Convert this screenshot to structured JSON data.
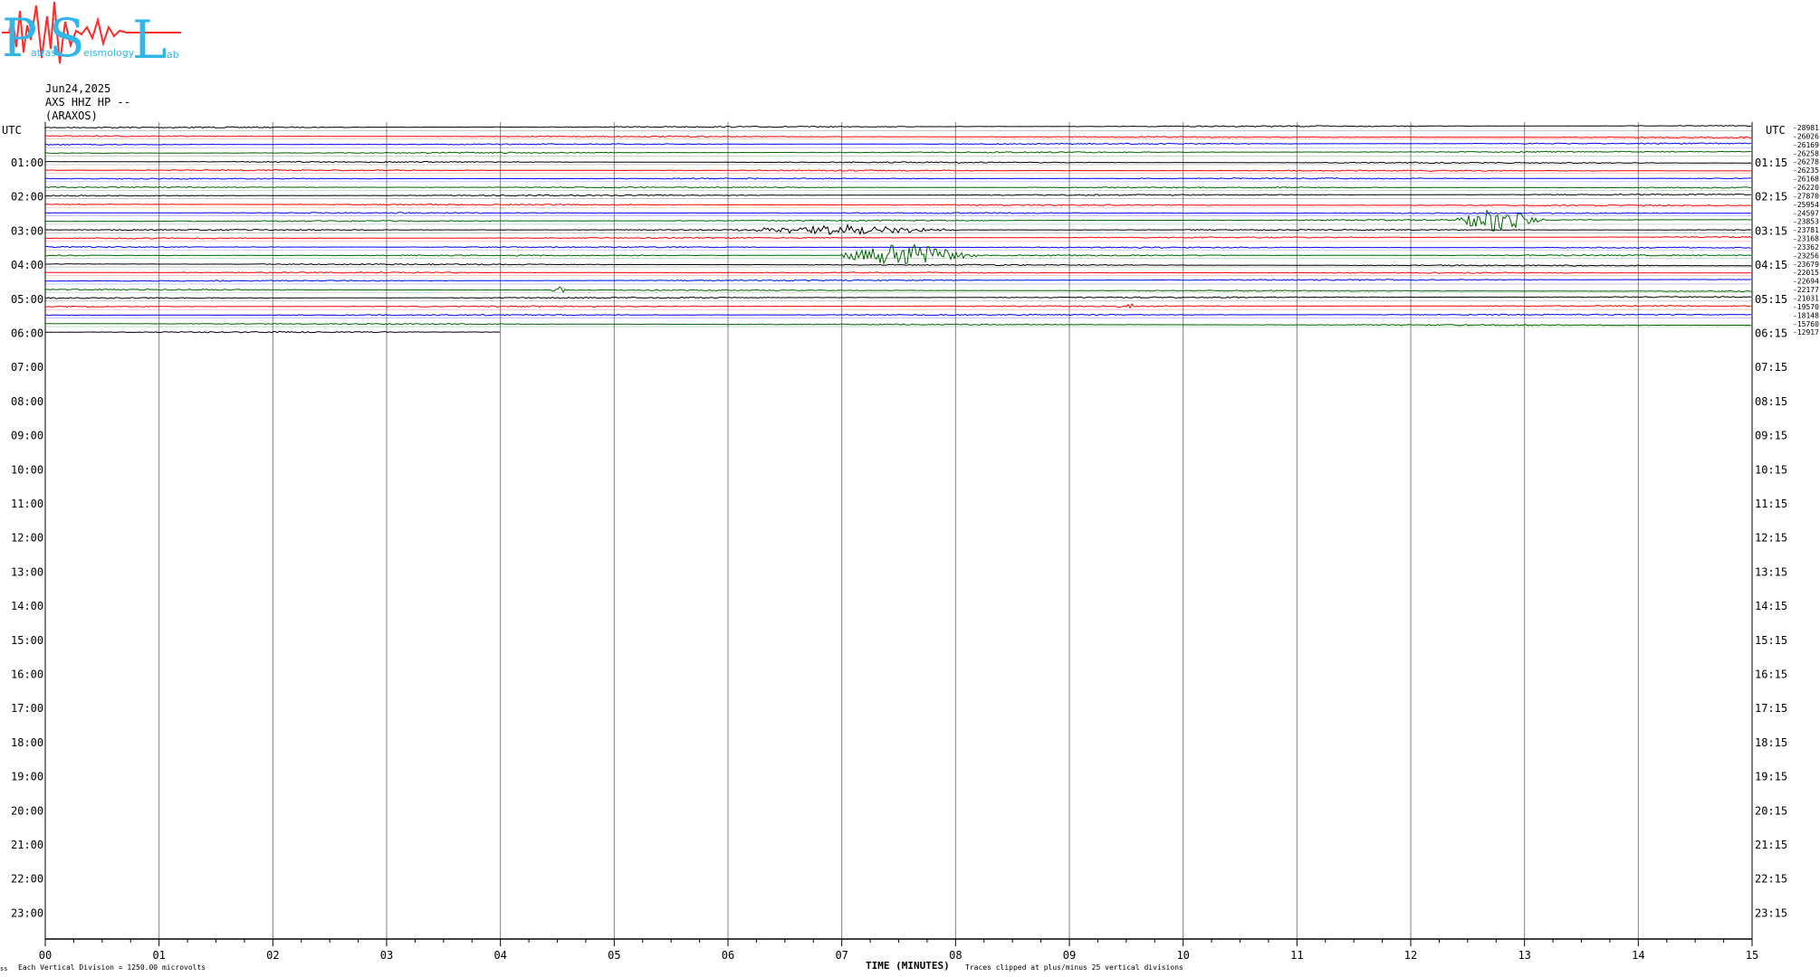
{
  "logo": {
    "letters": [
      "P",
      "S",
      "L"
    ],
    "small_words": [
      "atras",
      "eismology",
      "ab"
    ],
    "colors": {
      "letters": "#31b6e8",
      "wave": "#ff2a2a"
    }
  },
  "header": {
    "date": "Jun24,2025",
    "station_line": "AXS HHZ HP --",
    "station_name": "(ARAXOS)"
  },
  "footer": {
    "vertical_division": "Each Vertical Division = 1250.00 microvolts",
    "time_label": "TIME (MINUTES)",
    "clip_note": "Traces clipped at plus/minus 25 vertical divisions"
  },
  "chart_data": {
    "type": "line",
    "description_axes": {
      "x_ticks": [
        "00",
        "01",
        "02",
        "03",
        "04",
        "05",
        "06",
        "07",
        "08",
        "09",
        "10",
        "11",
        "12",
        "13",
        "14",
        "15"
      ],
      "x_range": [
        0,
        15
      ],
      "left_label": "UTC",
      "right_label": "UTC",
      "left_hours": [
        "01:00",
        "02:00",
        "03:00",
        "04:00",
        "05:00",
        "06:00",
        "07:00",
        "08:00",
        "09:00",
        "10:00",
        "11:00",
        "12:00",
        "13:00",
        "14:00",
        "15:00",
        "16:00",
        "17:00",
        "18:00",
        "19:00",
        "20:00",
        "21:00",
        "22:00",
        "23:00"
      ],
      "right_hours": [
        "01:15",
        "02:15",
        "03:15",
        "04:15",
        "05:15",
        "06:15",
        "07:15",
        "08:15",
        "09:15",
        "10:15",
        "11:15",
        "12:15",
        "13:15",
        "14:15",
        "15:15",
        "16:15",
        "17:15",
        "18:15",
        "19:15",
        "20:15",
        "21:15",
        "22:15",
        "23:15"
      ],
      "grid": true
    },
    "colors": {
      "cycle": [
        "#000000",
        "#ff0000",
        "#0000ff",
        "#006400"
      ],
      "grid": "#808080"
    },
    "offsets": [
      "-28981",
      "-26026",
      "-26169",
      "-26258",
      "-26278",
      "-26235",
      "-26168",
      "-26220",
      "-27870",
      "-25954",
      "-24597",
      "-23853",
      "-23781",
      "-23168",
      "-23362",
      "-23256",
      "-23679",
      "-22015",
      "-22694",
      "-22177",
      "-21031",
      "-19570",
      "-18148",
      "-15760",
      "-12917"
    ],
    "trace_count": 25,
    "partial_last_trace_end_min": 4.0,
    "events": [
      {
        "trace": 11,
        "start_min": 12.4,
        "end_min": 13.3,
        "peak_min": 12.75,
        "amplitude": 1.0
      },
      {
        "trace": 12,
        "start_min": 6.0,
        "end_min": 8.2,
        "peak_min": 7.0,
        "amplitude": 0.4
      },
      {
        "trace": 15,
        "start_min": 7.0,
        "end_min": 8.4,
        "peak_min": 7.55,
        "amplitude": 1.0
      },
      {
        "trace": 19,
        "start_min": 4.45,
        "end_min": 4.6,
        "peak_min": 4.5,
        "amplitude": 0.5
      },
      {
        "trace": 21,
        "start_min": 9.4,
        "end_min": 9.6,
        "peak_min": 9.5,
        "amplitude": 0.3
      }
    ]
  }
}
